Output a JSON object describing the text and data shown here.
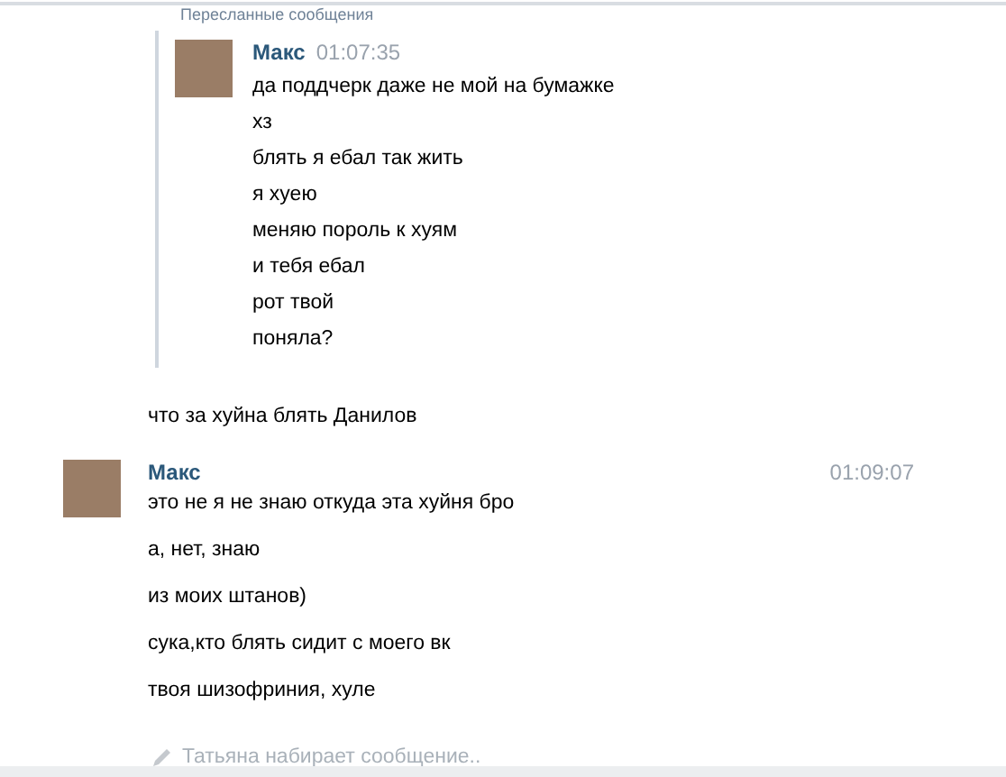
{
  "forwarded_header": {
    "label": "Пересланные сообщения"
  },
  "messages": [
    {
      "kind": "forwarded",
      "author": "Макс",
      "time": "01:07:35",
      "lines": [
        "да поддчерк даже не мой на бумажке",
        "хз",
        "блять я ебал так жить",
        "я хуею",
        "меняю пороль к хуям",
        "и тебя ебал",
        "рот твой",
        "поняла?"
      ]
    },
    {
      "kind": "plain",
      "lines": [
        "что за хуйна блять Данилов"
      ]
    },
    {
      "kind": "message",
      "author": "Макс",
      "time": "01:09:07",
      "lines": [
        "это не я не знаю откуда эта хуйня бро",
        "а, нет, знаю",
        "из моих штанов)",
        "сука,кто блять сидит с моего вк",
        "твоя шизофриния, хуле"
      ]
    }
  ],
  "typing_indicator": {
    "text": "Татьяна набирает сообщение.."
  }
}
